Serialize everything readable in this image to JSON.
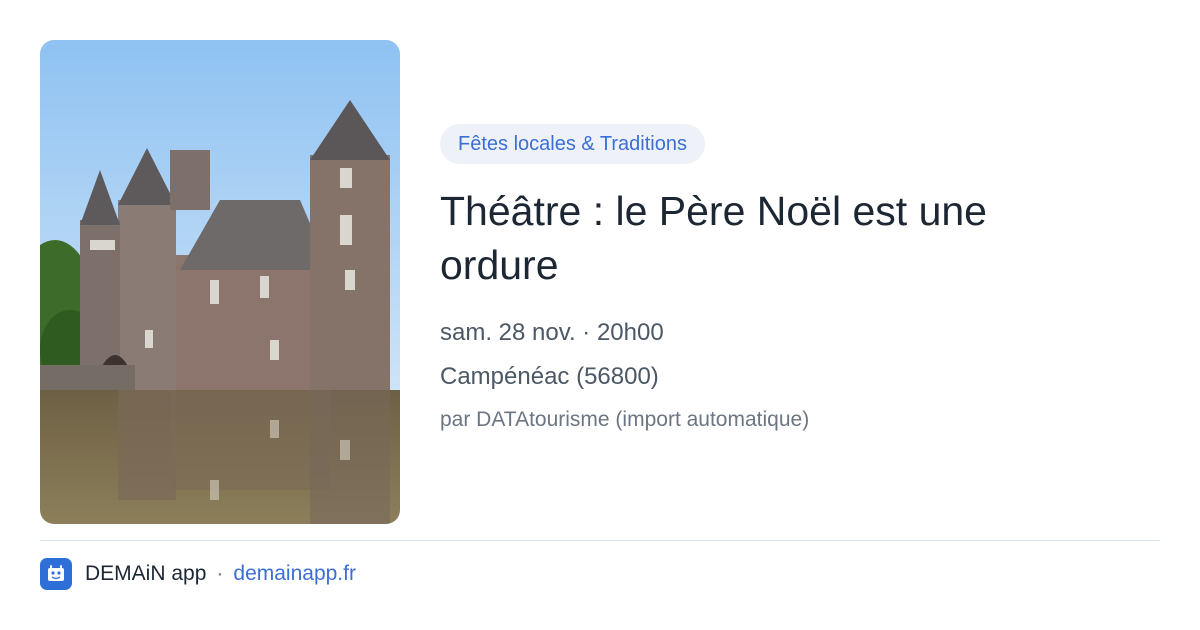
{
  "event": {
    "image_alt": "château",
    "category": "Fêtes locales & Traditions",
    "title": "Théâtre : le Père Noël est une ordure",
    "datetime": "sam. 28 nov. · 20h00",
    "location": "Campénéac (56800)",
    "source": "par DATAtourisme (import automatique)"
  },
  "footer": {
    "app_name": "DEMAiN app",
    "separator": "·",
    "domain": "demainapp.fr",
    "logo_icon": "demain-logo-icon"
  },
  "colors": {
    "accent": "#3b6fd4",
    "tag_bg": "#eef2f8",
    "title": "#1c2733"
  }
}
